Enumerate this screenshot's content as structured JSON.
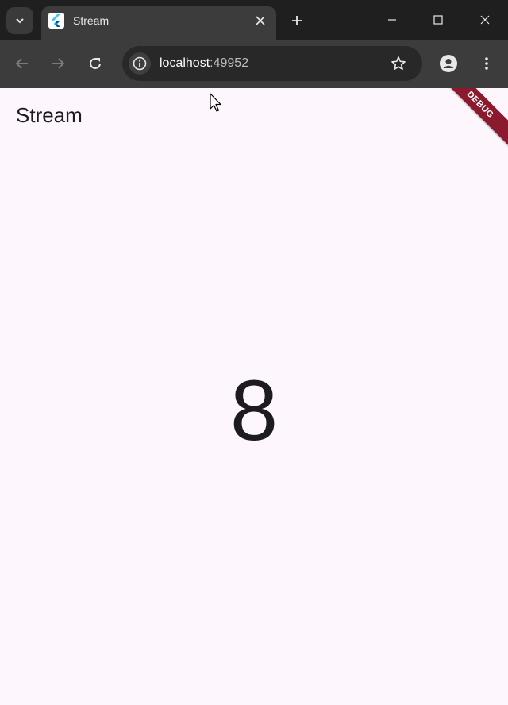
{
  "browser": {
    "tab": {
      "title": "Stream"
    },
    "address_bar": {
      "host": "localhost",
      "port": ":49952"
    }
  },
  "app": {
    "title": "Stream",
    "counter_value": "8",
    "debug_banner": "DEBUG"
  },
  "colors": {
    "page_background": "#fdf7fd",
    "chrome_dark": "#1f1f1f",
    "toolbar": "#3c3c3c",
    "debug_banner": "#8b1a2f"
  },
  "icons": [
    "tab-search-icon",
    "flutter-icon",
    "close-icon",
    "plus-icon",
    "minimize-icon",
    "maximize-icon",
    "window-close-icon",
    "back-arrow-icon",
    "forward-arrow-icon",
    "reload-icon",
    "info-icon",
    "star-icon",
    "profile-icon",
    "more-vert-icon",
    "mouse-cursor-icon"
  ]
}
